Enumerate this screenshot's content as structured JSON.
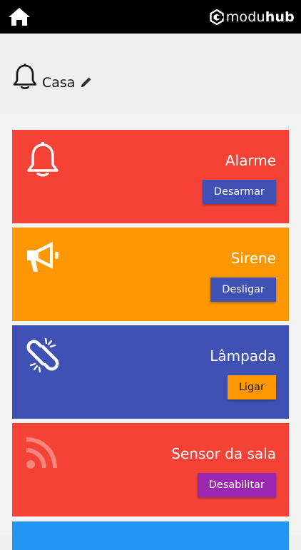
{
  "brand": {
    "light": "modu",
    "bold": "hub"
  },
  "header": {
    "title": "Casa"
  },
  "colors": {
    "red": "#f44336",
    "orange": "#ff9800",
    "indigo": "#3f51b5",
    "purple": "#9c27b0",
    "blue": "#2196f3"
  },
  "cards": [
    {
      "title": "Alarme",
      "action": "Desarmar",
      "icon": "bell-icon",
      "bg": "#f44336",
      "button_bg": "#3f51b5"
    },
    {
      "title": "Sirene",
      "action": "Desligar",
      "icon": "megaphone-icon",
      "bg": "#ff9800",
      "button_bg": "#3f51b5"
    },
    {
      "title": "Lâmpada",
      "action": "Ligar",
      "icon": "broken-link-icon",
      "bg": "#3f51b5",
      "button_bg": "#ff9800"
    },
    {
      "title": "Sensor da sala",
      "action": "Desabilitar",
      "icon": "rss-feed-icon",
      "bg": "#f44336",
      "button_bg": "#9c27b0"
    }
  ]
}
